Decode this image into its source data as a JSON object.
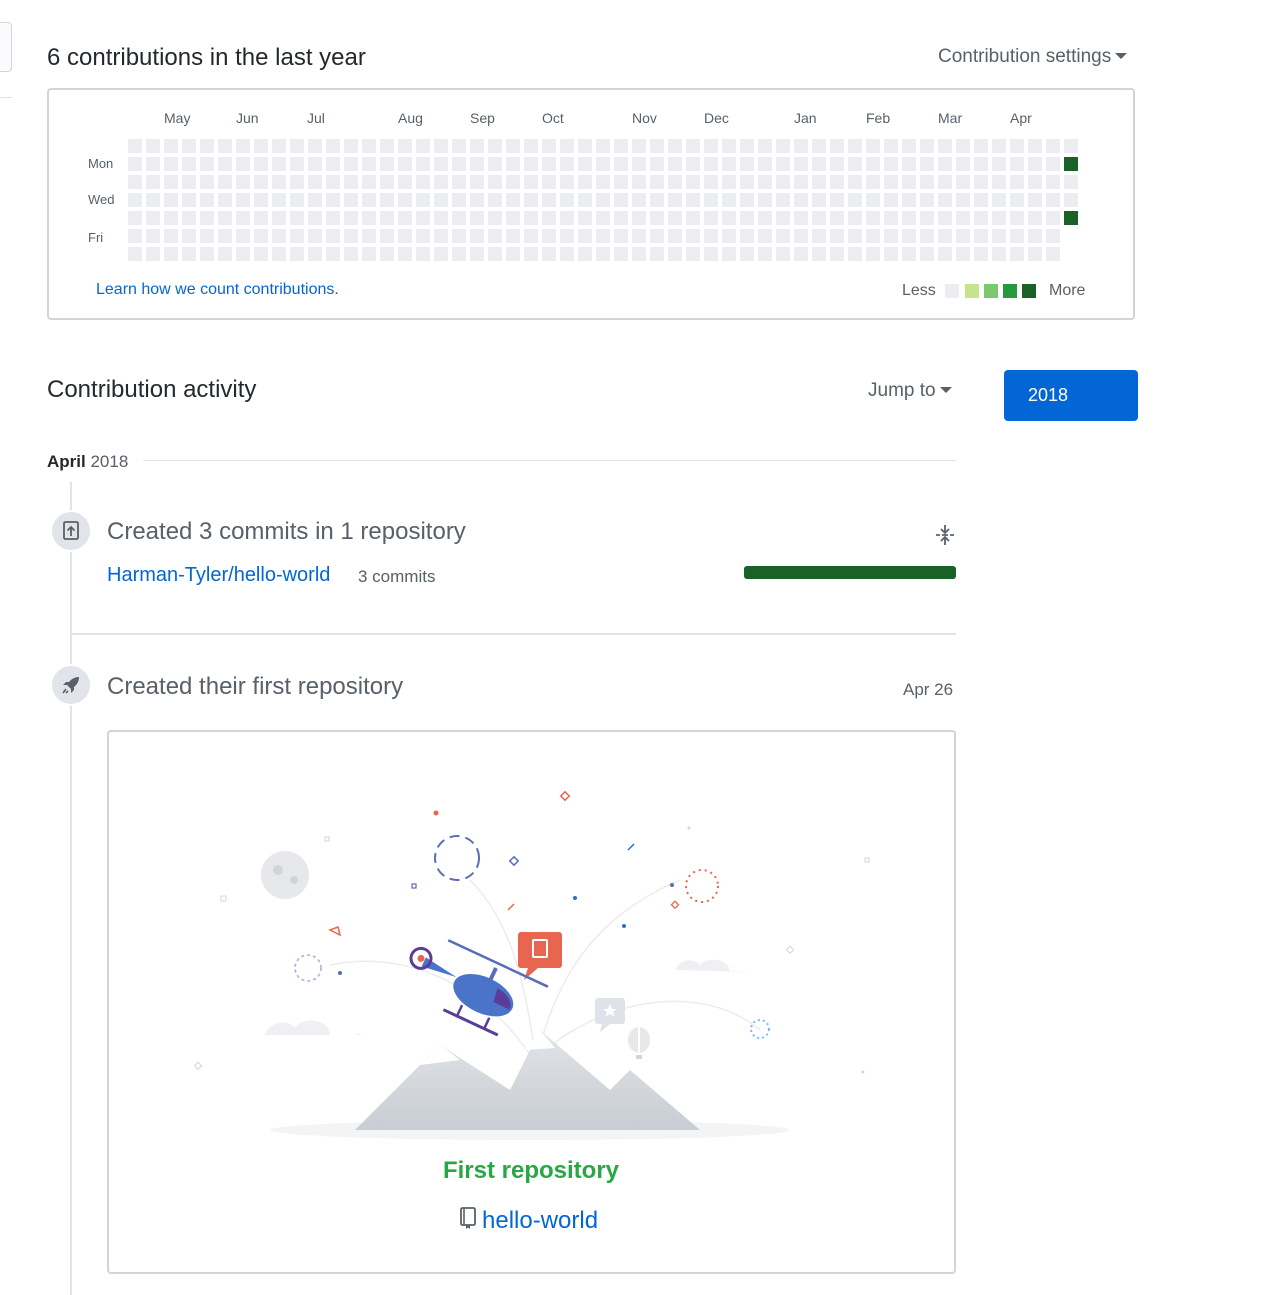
{
  "contributions": {
    "title": "6 contributions in the last year",
    "settings_label": "Contribution settings",
    "months": [
      "May",
      "Jun",
      "Jul",
      "Aug",
      "Sep",
      "Oct",
      "Nov",
      "Dec",
      "Jan",
      "Feb",
      "Mar",
      "Apr"
    ],
    "days": [
      "Mon",
      "Wed",
      "Fri"
    ],
    "learn_link": "Learn how we count contributions.",
    "legend": {
      "less": "Less",
      "more": "More"
    },
    "colors": {
      "empty": "#ebedf0",
      "level1": "#c6e48b",
      "level2": "#7bc96f",
      "level3": "#239a3b",
      "level4": "#196127"
    },
    "active_days": [
      {
        "week": 52,
        "day": 1,
        "level": 4
      },
      {
        "week": 52,
        "day": 4,
        "level": 4
      }
    ]
  },
  "activity": {
    "title": "Contribution activity",
    "jump_to": "Jump to",
    "year": "2018",
    "month": "April",
    "month_year": "2018",
    "commits": {
      "title": "Created 3 commits in 1 repository",
      "repo": "Harman-Tyler/hello-world",
      "count": "3 commits",
      "bar_fraction": 1.0
    },
    "first_repo": {
      "title": "Created their first repository",
      "date": "Apr 26",
      "label": "First repository",
      "repo_name": "hello-world"
    }
  }
}
